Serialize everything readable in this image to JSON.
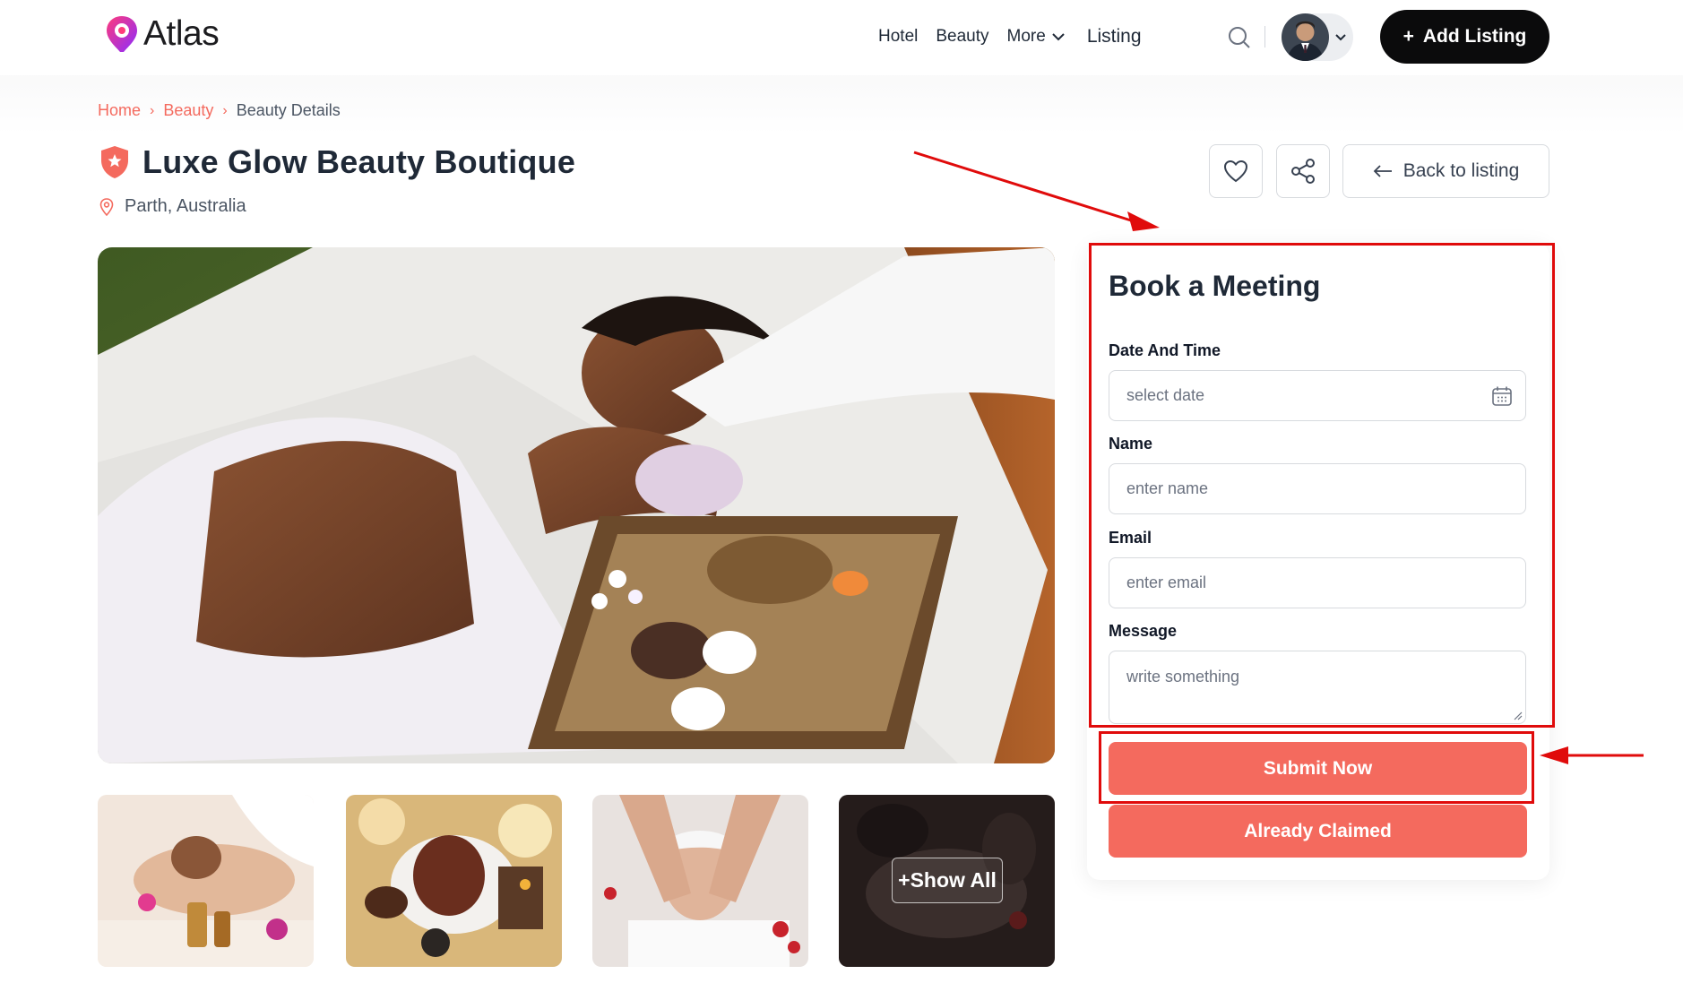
{
  "header": {
    "logo_text": "Atlas",
    "nav": {
      "hotel": "Hotel",
      "beauty": "Beauty",
      "more": "More",
      "listing": "Listing"
    },
    "add_listing": "Add Listing"
  },
  "breadcrumb": {
    "home": "Home",
    "beauty": "Beauty",
    "current": "Beauty Details"
  },
  "listing": {
    "title": "Luxe Glow Beauty Boutique",
    "location": "Parth, Australia"
  },
  "actions": {
    "back": "Back to listing"
  },
  "gallery": {
    "show_all": "+Show All"
  },
  "booking": {
    "title": "Book a Meeting",
    "date_label": "Date And Time",
    "date_placeholder": "select date",
    "name_label": "Name",
    "name_placeholder": "enter name",
    "email_label": "Email",
    "email_placeholder": "enter email",
    "message_label": "Message",
    "message_placeholder": "write something",
    "submit": "Submit Now",
    "claimed": "Already Claimed"
  },
  "colors": {
    "accent": "#f46a5e",
    "annotation": "#e00b0b",
    "dark_button": "#0b0b0c"
  }
}
